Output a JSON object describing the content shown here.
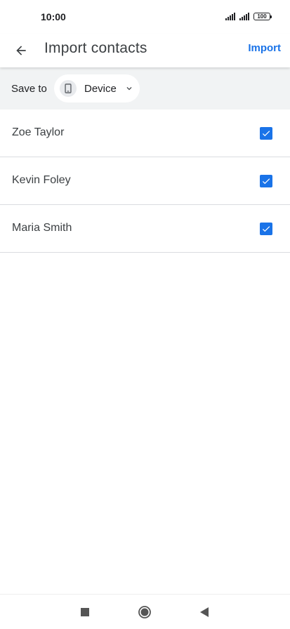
{
  "status_bar": {
    "time": "10:00",
    "battery": "100"
  },
  "app_bar": {
    "title": "Import contacts",
    "action_label": "Import"
  },
  "save_to": {
    "label": "Save to",
    "selected_account": "Device"
  },
  "contacts": [
    {
      "name": "Zoe Taylor",
      "checked": true
    },
    {
      "name": "Kevin Foley",
      "checked": true
    },
    {
      "name": "Maria Smith",
      "checked": true
    }
  ],
  "colors": {
    "accent": "#1a73e8",
    "save_bar_bg": "#f1f3f4",
    "divider": "#dadce0"
  },
  "icons": {
    "back": "arrow-back-icon",
    "device": "smartphone-icon",
    "dropdown": "chevron-down-icon",
    "checkbox": "check-icon",
    "nav_recent": "square-icon",
    "nav_home": "circle-icon",
    "nav_back": "triangle-back-icon"
  }
}
